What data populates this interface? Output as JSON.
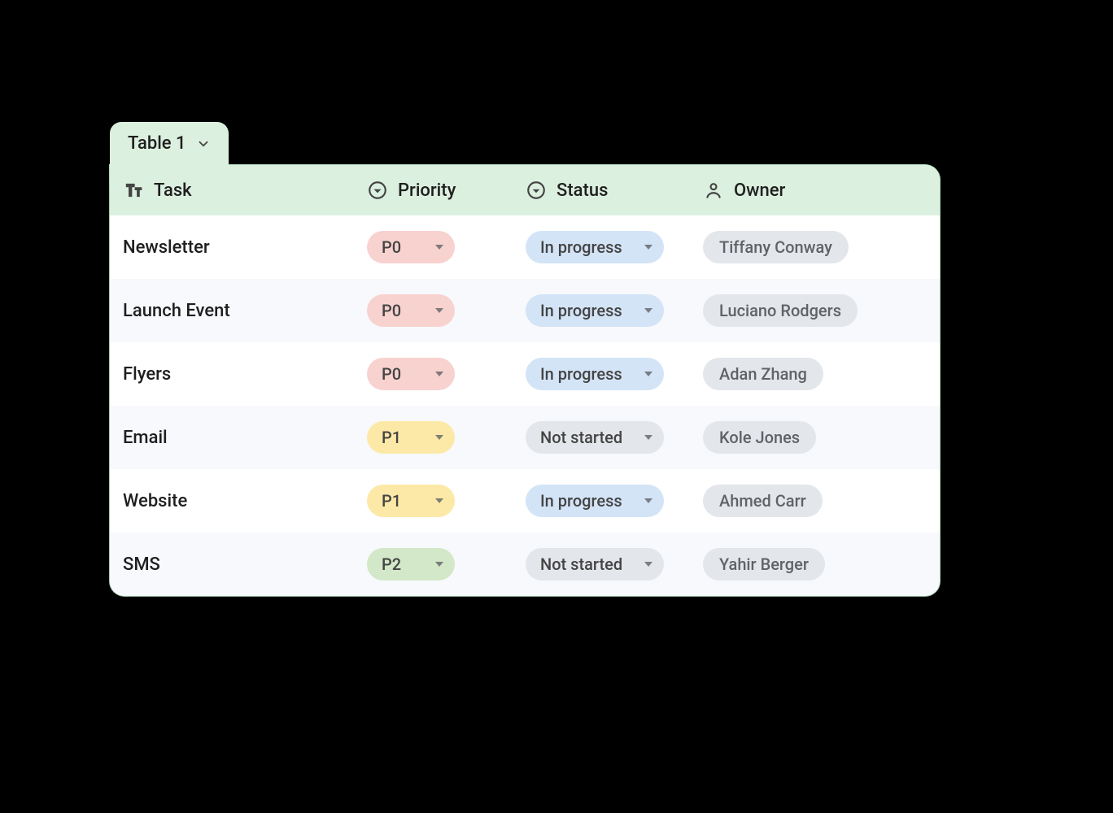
{
  "tab": {
    "label": "Table 1"
  },
  "columns": {
    "task": "Task",
    "priority": "Priority",
    "status": "Status",
    "owner": "Owner"
  },
  "priority_colors": {
    "P0": "#f8d2cf",
    "P1": "#fde9a7",
    "P2": "#d2e8c8"
  },
  "status_colors": {
    "In progress": "#d3e4f7",
    "Not started": "#e3e6ea"
  },
  "rows": [
    {
      "task": "Newsletter",
      "priority": "P0",
      "status": "In progress",
      "owner": "Tiffany Conway"
    },
    {
      "task": "Launch Event",
      "priority": "P0",
      "status": "In progress",
      "owner": "Luciano Rodgers"
    },
    {
      "task": "Flyers",
      "priority": "P0",
      "status": "In progress",
      "owner": "Adan Zhang"
    },
    {
      "task": "Email",
      "priority": "P1",
      "status": "Not started",
      "owner": "Kole Jones"
    },
    {
      "task": "Website",
      "priority": "P1",
      "status": "In progress",
      "owner": "Ahmed Carr"
    },
    {
      "task": "SMS",
      "priority": "P2",
      "status": "Not started",
      "owner": "Yahir Berger"
    }
  ]
}
